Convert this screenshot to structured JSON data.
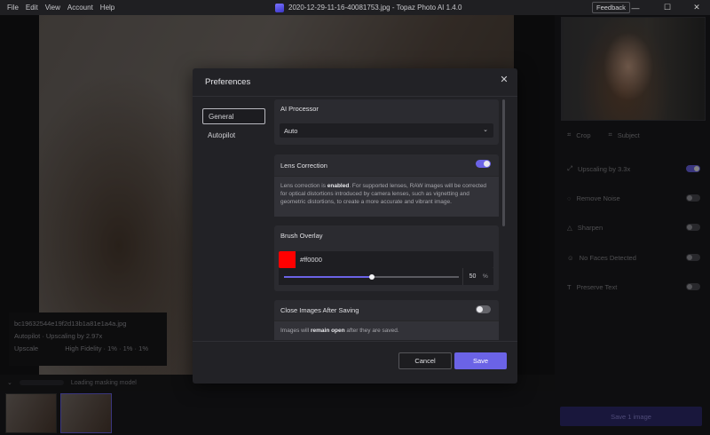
{
  "window": {
    "title": "2020-12-29-11-16-40081753.jpg - Topaz Photo AI 1.4.0",
    "menu": [
      "File",
      "Edit",
      "View",
      "Account",
      "Help"
    ],
    "feedback": "Feedback",
    "controls": {
      "minimize": "—",
      "maximize": "☐",
      "close": "✕"
    }
  },
  "right_panel": {
    "tools": [
      {
        "label": "Crop"
      },
      {
        "label": "Subject"
      }
    ],
    "filters": [
      {
        "label": "Upscaling by 3.3x",
        "enabled": true
      },
      {
        "label": "Remove Noise",
        "enabled": false
      },
      {
        "label": "Sharpen",
        "enabled": false
      },
      {
        "label": "No Faces Detected",
        "enabled": false
      },
      {
        "label": "Preserve Text",
        "enabled": false
      }
    ],
    "export_label": "Save 1 image"
  },
  "file_info": {
    "filename": "bc19632544e19f2d13b1a81e1a4a.jpg",
    "autopilot": "Autopilot · Upscaling by 2.97x",
    "upscale": "Upscale",
    "upscale_detail": "High Fidelity · 1% · 1% · 1%"
  },
  "status": {
    "message": "Loading masking model"
  },
  "dialog": {
    "title": "Preferences",
    "close": "✕",
    "nav": [
      {
        "label": "General",
        "active": true
      },
      {
        "label": "Autopilot",
        "active": false
      }
    ],
    "ai_processor": {
      "heading": "AI Processor",
      "value": "Auto"
    },
    "lens_correction": {
      "heading": "Lens Correction",
      "enabled": true,
      "text_pre": "Lens correction is ",
      "text_bold": "enabled",
      "text_post": ". For supported lenses, RAW images will be corrected for optical distortions introduced by camera lenses, such as vignetting and geometric distortions, to create a more accurate and vibrant image."
    },
    "brush_overlay": {
      "heading": "Brush Overlay",
      "color_hex": "#ff0000",
      "color_label": "#ff0000",
      "opacity": 50,
      "opacity_label": "50",
      "unit": "%"
    },
    "close_after_saving": {
      "heading": "Close Images After Saving",
      "enabled": false,
      "text_pre": "Images will ",
      "text_bold": "remain open",
      "text_post": " after they are saved."
    },
    "cancel_label": "Cancel",
    "save_label": "Save"
  },
  "colors": {
    "accent": "#6b63e6",
    "background": "#1a1a1c",
    "dialog": "#222226"
  }
}
